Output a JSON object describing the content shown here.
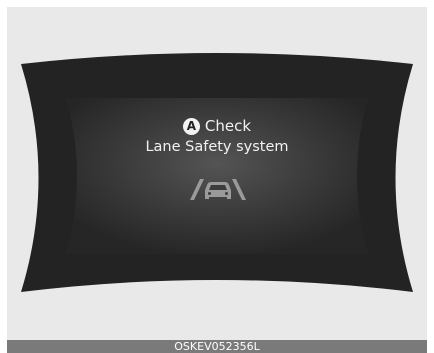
{
  "display": {
    "indicator_letter": "A",
    "line1": "Check",
    "line2": "Lane Safety system"
  },
  "icons": {
    "warning_icon": "lane-safety-icon"
  },
  "caption": "OSKEV052356L",
  "colors": {
    "background": "#e9e9ea",
    "panel": "#222222",
    "text": "#f2f2f2",
    "caption_bar": "#7a7a7a"
  }
}
